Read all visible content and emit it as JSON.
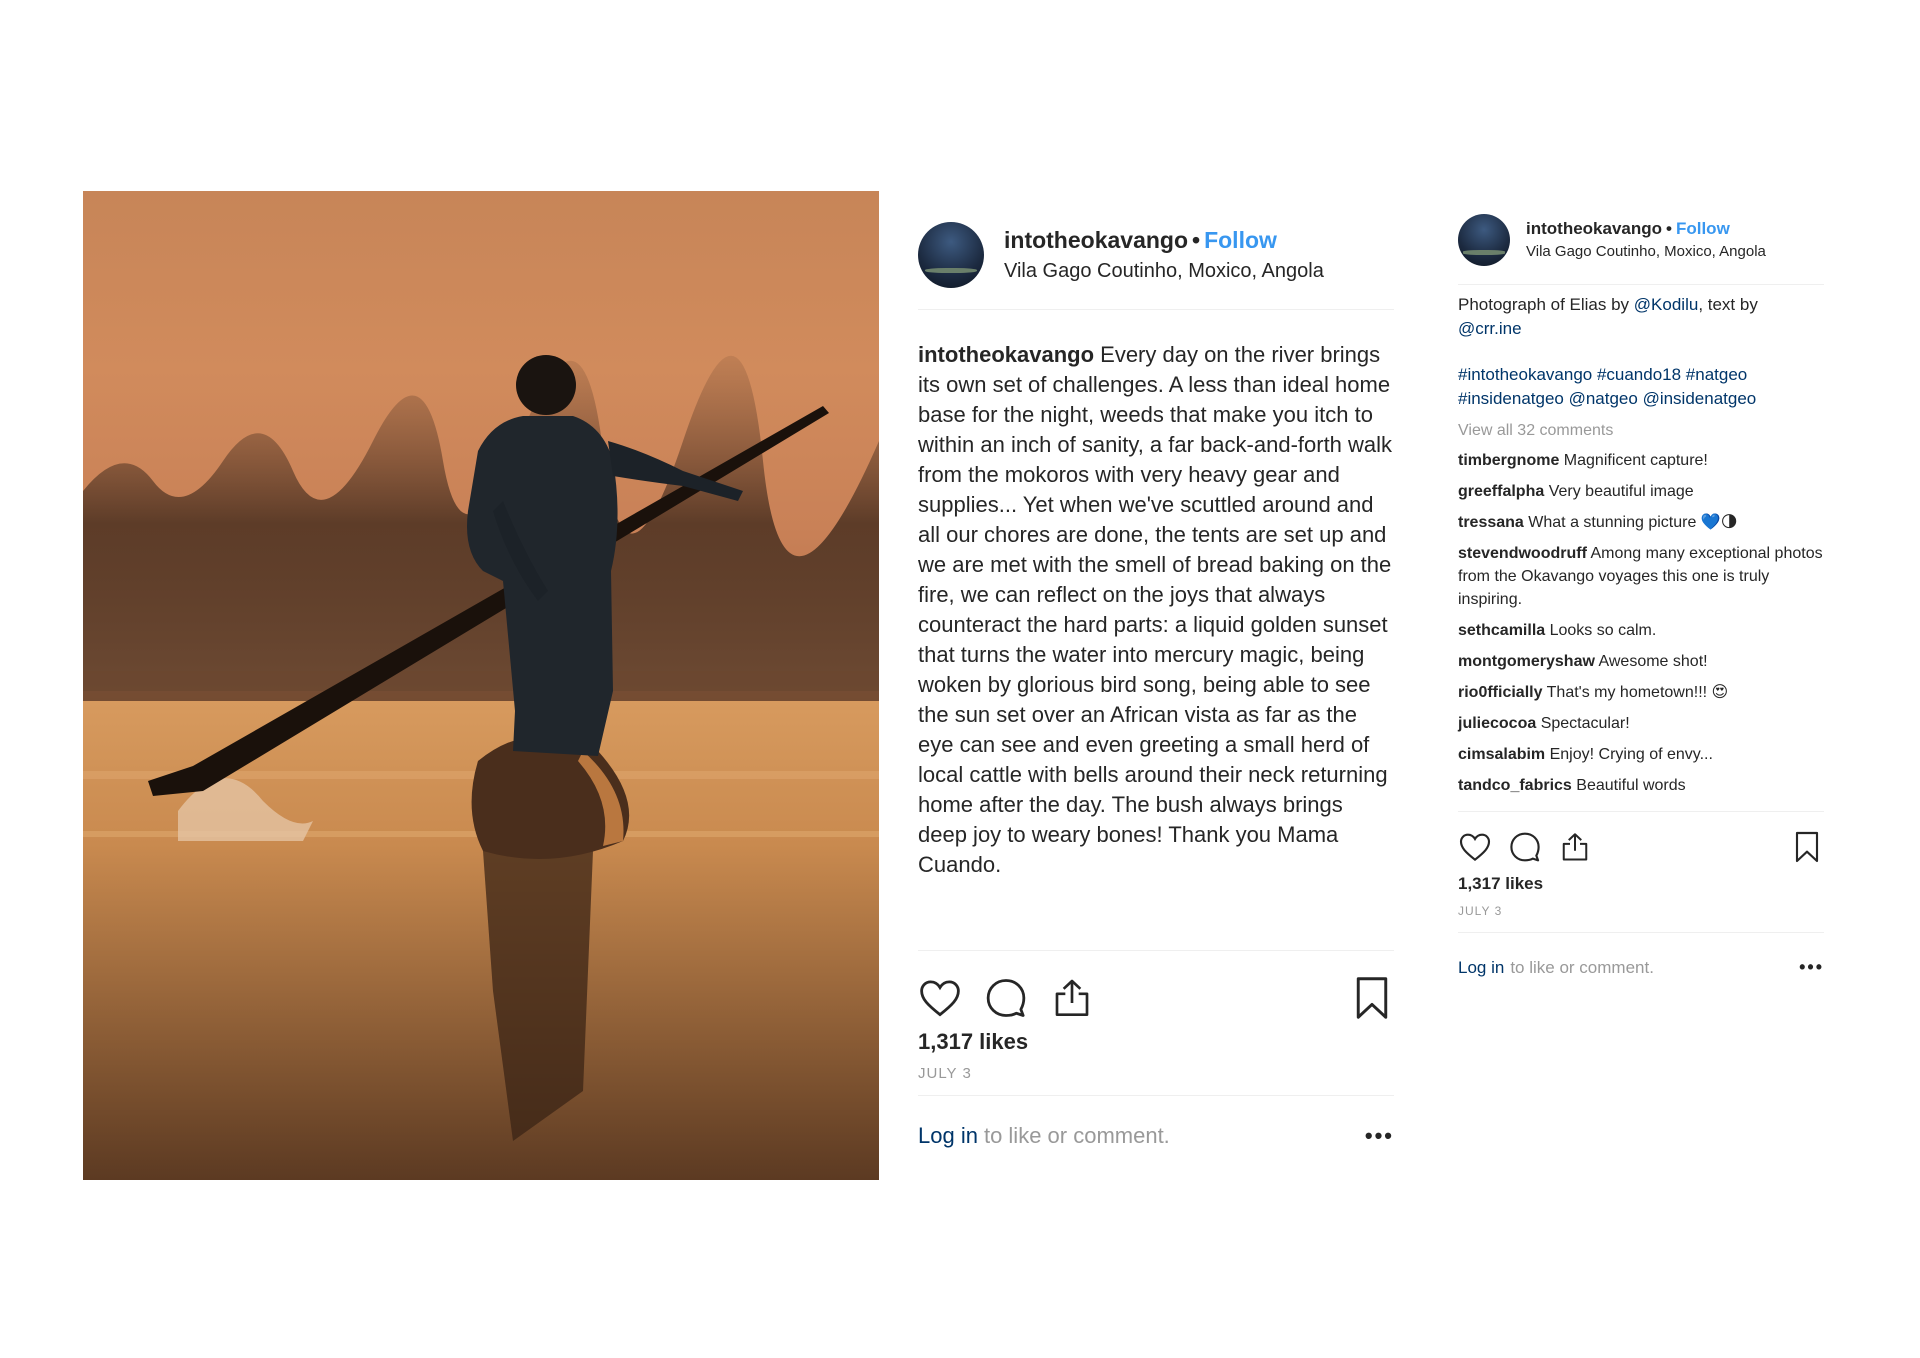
{
  "post": {
    "username": "intotheokavango",
    "separator": "•",
    "follow_label": "Follow",
    "location": "Vila Gago Coutinho, Moxico, Angola",
    "caption": "Every day on the river brings its own set of challenges. A less than ideal home base for the night, weeds that make you itch to within an inch of sanity, a far back-and-forth walk from the mokoros with very heavy gear and supplies... Yet when we've scuttled around and all our chores are done, the tents are set up and we are met with the smell of bread baking on the fire, we can reflect on the joys that always counteract the hard parts: a liquid golden sunset that turns the water into mercury magic, being woken by glorious bird song, being able to see the sun set over an African vista as far as the eye can see and even greeting a small herd of local cattle with bells around their neck returning home after the day. The bush always brings deep joy to weary bones! Thank you Mama Cuando.",
    "likes": "1,317 likes",
    "date": "JULY 3",
    "login_link": "Log in",
    "login_rest": "to like or comment.",
    "more_label": "•••"
  },
  "small_post": {
    "credit_prefix": "Photograph of Elias by",
    "credit_mention1": "@Kodilu",
    "credit_middle": ", text by",
    "credit_mention2": "@crr.ine",
    "tags_line1": "#intotheokavango #cuando18 #natgeo",
    "tags_line2": "#insidenatgeo @natgeo @insidenatgeo",
    "view_all": "View all 32 comments",
    "comments": [
      {
        "user": "timbergnome",
        "text": "Magnificent capture!"
      },
      {
        "user": "greeffalpha",
        "text": "Very beautiful image"
      },
      {
        "user": "tressana",
        "text": "What a stunning picture 💙🌗"
      },
      {
        "user": "stevendwoodruff",
        "text": "Among many exceptional photos from the Okavango voyages this one is truly inspiring."
      },
      {
        "user": "sethcamilla",
        "text": "Looks so calm."
      },
      {
        "user": "montgomeryshaw",
        "text": "Awesome shot!"
      },
      {
        "user": "rio0fficially",
        "text": "That's my hometown!!! 😍"
      },
      {
        "user": "juliecocoa",
        "text": "Spectacular!"
      },
      {
        "user": "cimsalabim",
        "text": "Enjoy! Crying of envy..."
      },
      {
        "user": "tandco_fabrics",
        "text": "Beautiful words"
      }
    ]
  },
  "icons": {
    "like": "heart-icon",
    "comment": "speech-bubble-icon",
    "share": "share-icon",
    "save": "bookmark-icon"
  },
  "colors": {
    "link_blue": "#3897f0",
    "dark_link": "#003569",
    "muted": "#999999"
  }
}
